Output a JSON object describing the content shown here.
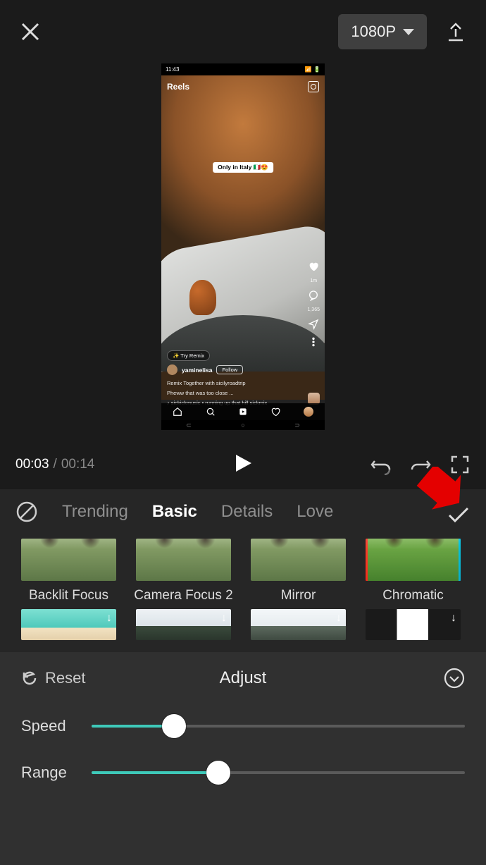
{
  "topbar": {
    "resolution": "1080P"
  },
  "preview": {
    "status_time": "11:43",
    "header": "Reels",
    "caption_pill": "Only in Italy 🇮🇹😍",
    "try_remix": "✨ Try Remix",
    "username": "yaminelisa",
    "follow": "Follow",
    "remix_line": "Remix Together with sicilyroadtrip",
    "desc": "Pheww that was too close ...",
    "audio": "♪ sickickmusic • running up that hill sickmix",
    "likes": "1m",
    "comments": "1,365"
  },
  "playback": {
    "current": "00:03",
    "total": "00:14"
  },
  "tabs": [
    "Trending",
    "Basic",
    "Details",
    "Love"
  ],
  "active_tab": "Basic",
  "effects_row1": [
    {
      "label": "Backlit Focus"
    },
    {
      "label": "Camera Focus 2"
    },
    {
      "label": "Mirror"
    },
    {
      "label": "Chromatic"
    }
  ],
  "adjust": {
    "reset": "Reset",
    "title": "Adjust",
    "sliders": [
      {
        "label": "Speed",
        "value": 22
      },
      {
        "label": "Range",
        "value": 34
      }
    ]
  }
}
